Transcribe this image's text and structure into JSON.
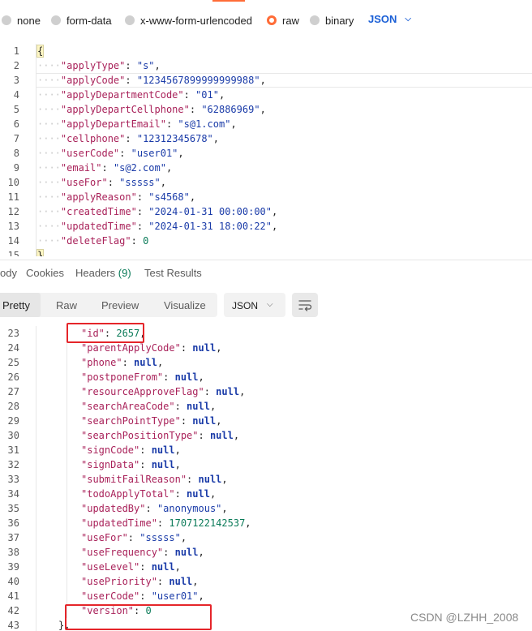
{
  "body_types": [
    {
      "label": "none",
      "selected": false
    },
    {
      "label": "form-data",
      "selected": false
    },
    {
      "label": "x-www-form-urlencoded",
      "selected": false
    },
    {
      "label": "raw",
      "selected": true
    },
    {
      "label": "binary",
      "selected": false
    }
  ],
  "raw_format": "JSON",
  "request_lines": [
    {
      "n": "1",
      "key": "",
      "val": "",
      "type": "open"
    },
    {
      "n": "2",
      "key": "applyType",
      "val": "s",
      "type": "str"
    },
    {
      "n": "3",
      "key": "applyCode",
      "val": "1234567899999999988",
      "type": "str"
    },
    {
      "n": "4",
      "key": "applyDepartmentCode",
      "val": "01",
      "type": "str"
    },
    {
      "n": "5",
      "key": "applyDepartCellphone",
      "val": "62886969",
      "type": "str"
    },
    {
      "n": "6",
      "key": "applyDepartEmail",
      "val": "s@1.com",
      "type": "str"
    },
    {
      "n": "7",
      "key": "cellphone",
      "val": "12312345678",
      "type": "str"
    },
    {
      "n": "8",
      "key": "userCode",
      "val": "user01",
      "type": "str"
    },
    {
      "n": "9",
      "key": "email",
      "val": "s@2.com",
      "type": "str"
    },
    {
      "n": "10",
      "key": "useFor",
      "val": "sssss",
      "type": "str"
    },
    {
      "n": "11",
      "key": "applyReason",
      "val": "s4568",
      "type": "str"
    },
    {
      "n": "12",
      "key": "createdTime",
      "val": "2024-01-31 00:00:00",
      "type": "str"
    },
    {
      "n": "13",
      "key": "updatedTime",
      "val": "2024-01-31 18:00:22",
      "type": "str"
    },
    {
      "n": "14",
      "key": "deleteFlag",
      "val": "0",
      "type": "num"
    },
    {
      "n": "15",
      "key": "",
      "val": "",
      "type": "close"
    }
  ],
  "response_tabs": {
    "body": "ody",
    "cookies": "Cookies",
    "headers": "Headers",
    "headers_count": "(9)",
    "test_results": "Test Results"
  },
  "view_modes": {
    "pretty": "Pretty",
    "raw": "Raw",
    "preview": "Preview",
    "visualize": "Visualize"
  },
  "response_format": "JSON",
  "response_lines": [
    {
      "n": "23",
      "key": "id",
      "val": "2657",
      "type": "num"
    },
    {
      "n": "24",
      "key": "parentApplyCode",
      "val": "null",
      "type": "null"
    },
    {
      "n": "25",
      "key": "phone",
      "val": "null",
      "type": "null"
    },
    {
      "n": "26",
      "key": "postponeFrom",
      "val": "null",
      "type": "null"
    },
    {
      "n": "27",
      "key": "resourceApproveFlag",
      "val": "null",
      "type": "null"
    },
    {
      "n": "28",
      "key": "searchAreaCode",
      "val": "null",
      "type": "null"
    },
    {
      "n": "29",
      "key": "searchPointType",
      "val": "null",
      "type": "null"
    },
    {
      "n": "30",
      "key": "searchPositionType",
      "val": "null",
      "type": "null"
    },
    {
      "n": "31",
      "key": "signCode",
      "val": "null",
      "type": "null"
    },
    {
      "n": "32",
      "key": "signData",
      "val": "null",
      "type": "null"
    },
    {
      "n": "33",
      "key": "submitFailReason",
      "val": "null",
      "type": "null"
    },
    {
      "n": "34",
      "key": "todoApplyTotal",
      "val": "null",
      "type": "null"
    },
    {
      "n": "35",
      "key": "updatedBy",
      "val": "anonymous",
      "type": "str"
    },
    {
      "n": "36",
      "key": "updatedTime",
      "val": "1707122142537",
      "type": "num"
    },
    {
      "n": "37",
      "key": "useFor",
      "val": "sssss",
      "type": "str"
    },
    {
      "n": "38",
      "key": "useFrequency",
      "val": "null",
      "type": "null"
    },
    {
      "n": "39",
      "key": "useLevel",
      "val": "null",
      "type": "null"
    },
    {
      "n": "40",
      "key": "usePriority",
      "val": "null",
      "type": "null"
    },
    {
      "n": "41",
      "key": "userCode",
      "val": "user01",
      "type": "str"
    },
    {
      "n": "42",
      "key": "version",
      "val": "0",
      "type": "num",
      "last": true
    },
    {
      "n": "43",
      "key": "",
      "val": "",
      "type": "close"
    }
  ],
  "watermark": "CSDN @LZHH_2008",
  "colors": {
    "accent": "#ff6c37",
    "key": "#a9225a",
    "string": "#1a3ba8",
    "number": "#0b7b59",
    "null": "#1a3ba8",
    "highlight": "#e5252a"
  },
  "icons": {
    "format_chevron": "chevron-down-icon",
    "wrap": "wrap-lines-icon"
  }
}
